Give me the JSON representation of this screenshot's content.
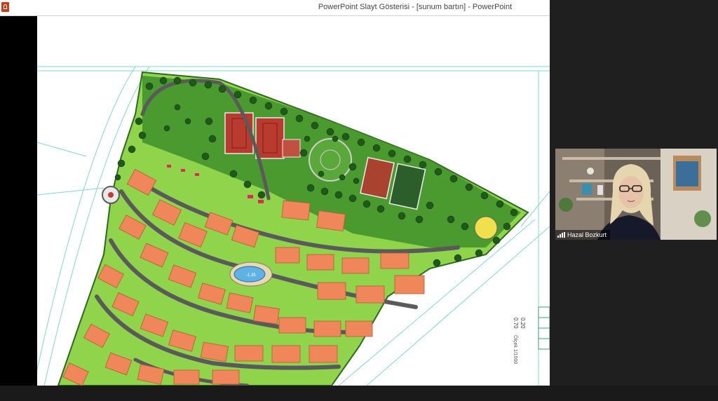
{
  "window": {
    "title": "PowerPoint Slayt Gösterisi - [sunum bartın] - PowerPoint",
    "app_icon": "powerpoint-icon"
  },
  "slide": {
    "content": "site-plan-drawing",
    "pool_label": "-1.35",
    "side_annotation_1": "Ölçek 1/1000",
    "side_annotation_2": "0.20",
    "side_annotation_3": "0.70",
    "colors": {
      "lawn": "#8fd44a",
      "lawn_dark": "#3f8f2a",
      "roof": "#f0875a",
      "road": "#5a5a5a",
      "court": "#b93b2e",
      "water": "#5fb2e6"
    }
  },
  "participant": {
    "name": "Hazal Bozkurt",
    "icon": "signal-bars-icon"
  }
}
